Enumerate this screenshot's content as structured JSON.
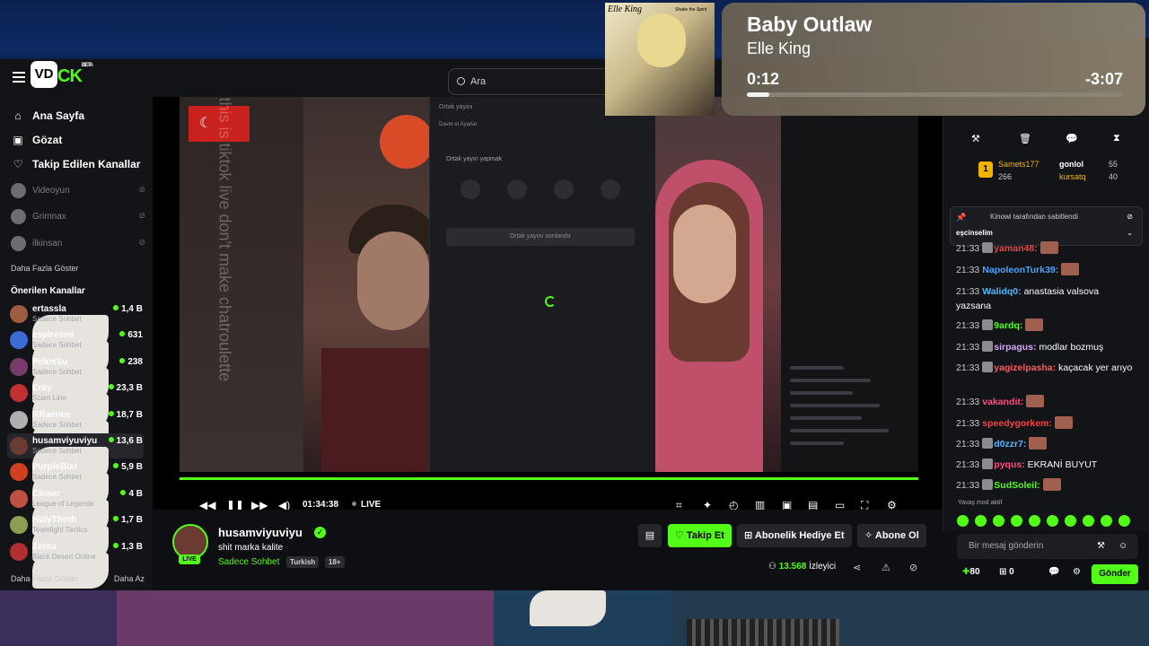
{
  "app": {
    "brand_box": "VD",
    "brand_text": "CK",
    "brand_badge": "BETA"
  },
  "search": {
    "placeholder": "Ara"
  },
  "nav": [
    {
      "icon": "home-icon",
      "label": "Ana Sayfa"
    },
    {
      "icon": "browse-icon",
      "label": "Gözat"
    },
    {
      "icon": "heart-icon",
      "label": "Takip Edilen Kanallar"
    }
  ],
  "followed": [
    {
      "name": "Videoyun"
    },
    {
      "name": "Grimnax"
    },
    {
      "name": "ilkinsan"
    }
  ],
  "sidebar_more": "Daha Fazla Göster",
  "sidebar_less": "Daha Az",
  "recommended_title": "Önerilen Kanallar",
  "recommended": [
    {
      "name": "ertassla",
      "category": "Sadece Sohbet",
      "viewers": "1,4 B",
      "color": "#a05c40"
    },
    {
      "name": "espiresmi",
      "category": "Sadece Sohbet",
      "viewers": "631",
      "color": "#3b6bd4"
    },
    {
      "name": "PelosSu",
      "category": "Sadece Sohbet",
      "viewers": "238",
      "color": "#7a3b6b"
    },
    {
      "name": "Eray",
      "category": "Scam Line",
      "viewers": "23,3 B",
      "color": "#c03030"
    },
    {
      "name": "RRaenee",
      "category": "Sadece Sohbet",
      "viewers": "18,7 B",
      "color": "#b0b0b0"
    },
    {
      "name": "husamviyuviyu",
      "category": "Sadece Sohbet",
      "viewers": "13,6 B",
      "color": "#6b3b32"
    },
    {
      "name": "PurpleBixi",
      "category": "Sadece Sohbet",
      "viewers": "5,9 B",
      "color": "#d04020"
    },
    {
      "name": "Closer",
      "category": "League of Legends",
      "viewers": "4 B",
      "color": "#c05040"
    },
    {
      "name": "HolyThoth",
      "category": "Teamfight Tactics",
      "viewers": "1,7 B",
      "color": "#8aa050"
    },
    {
      "name": "Zetsu",
      "category": "Black Desert Online",
      "viewers": "1,3 B",
      "color": "#b03030"
    }
  ],
  "video": {
    "overlay_text": "this is tiktok live don't make chatroulette",
    "modal_title": "Ortak yayını",
    "modal_tabs": "Davet et    Ayarlar",
    "modal_heading": "Ortak yayın yapmak",
    "modal_button": "Ortak yayını sonlandır"
  },
  "player": {
    "time": "01:34:38",
    "live": "LIVE"
  },
  "stream": {
    "name": "husamviyuviyu",
    "title": "shit marka kalite",
    "category": "Sadece Sohbet",
    "tags": [
      "Turkish",
      "18+"
    ],
    "live_badge": "LIVE",
    "follow": "Takip Et",
    "gift": "Abonelik Hediye Et",
    "subscribe": "Abone Ol",
    "viewers": "13.568",
    "viewers_label": "İzleyici"
  },
  "chat": {
    "leaders": [
      {
        "rank": "1",
        "name": "Samets177",
        "value": "266",
        "name2": "gonlol",
        "value2": "55",
        "name3": "kursatq",
        "value3": "40"
      }
    ],
    "pinned": {
      "by": "Kinowi tarafından sabitlendi",
      "text": "eşcinselim"
    },
    "messages": [
      {
        "time": "21:33",
        "user": "yaman48:",
        "color": "#e04a4a",
        "text": ""
      },
      {
        "time": "21:33",
        "user": "NapoleonTurk39:",
        "color": "#4aa3ff",
        "text": ""
      },
      {
        "time": "21:33",
        "user": "Walidq0:",
        "color": "#53b6ff",
        "text": "anastasia valsova yazsana"
      },
      {
        "time": "21:33",
        "user": "9ardq:",
        "color": "#53fc18",
        "text": ""
      },
      {
        "time": "21:33",
        "user": "sirpagus:",
        "color": "#d8a6ff",
        "text": "modlar bozmuş"
      },
      {
        "time": "21:33",
        "user": "yagizelpasha:",
        "color": "#ff5a5a",
        "text": "kaçacak yer arıyo"
      },
      {
        "time": "21:33",
        "user": "vakandit:",
        "color": "#ff4d7d",
        "text": ""
      },
      {
        "time": "21:33",
        "user": "speedygorkem:",
        "color": "#ff4040",
        "text": ""
      },
      {
        "time": "21:33",
        "user": "d0zzr7:",
        "color": "#53b6ff",
        "text": ""
      },
      {
        "time": "21:33",
        "user": "pyqus:",
        "color": "#ff4d7d",
        "text": "EKRANİ BUYUT"
      },
      {
        "time": "21:33",
        "user": "SudSoleil:",
        "color": "#53fc18",
        "text": ""
      }
    ],
    "slow_mode": "Yavaş mod aktif",
    "input_placeholder": "Bir mesaj gönderin",
    "points": "80",
    "count": "0",
    "send": "Gönder"
  },
  "music": {
    "title": "Baby Outlaw",
    "artist": "Elle King",
    "elapsed": "0:12",
    "remaining": "-3:07",
    "progress_pct": 6,
    "album_caption": "Elle King",
    "album_caption2": "Shake the Spirit"
  }
}
